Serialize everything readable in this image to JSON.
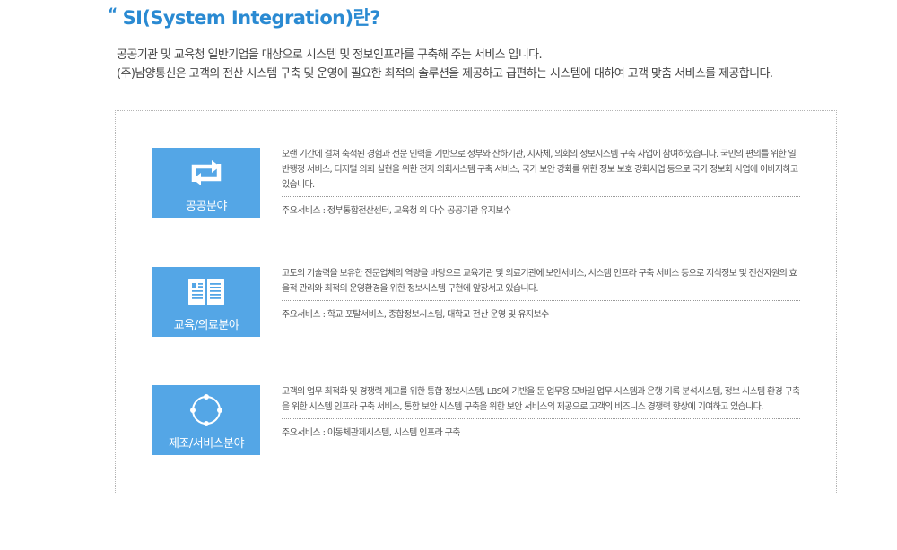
{
  "title": {
    "quote": "“",
    "text": "SI(System Integration)란?"
  },
  "intro": [
    "공공기관 및 교육청 일반기업을 대상으로 시스템 및 정보인프라를 구축해 주는 서비스 입니다.",
    "(주)남양통신은 고객의 전산 시스템 구축 및 운영에 필요한 최적의 솔루션을 제공하고 급편하는 시스템에 대하여 고객  맞춤 서비스를  제공합니다."
  ],
  "services": [
    {
      "icon": "cycle-arrows-icon",
      "label": "공공분야",
      "description": "오랜 기간에 걸쳐 축적된 경험과 전문 인력을 기반으로 정부와 산하기관, 지자체, 의회의 정보시스템 구축 사업에 참여하였습니다. 국민의 편의를 위한 일반행정 서비스, 디지털 의회 실현을 위한 전자 의회시스템 구축 서비스, 국가 보안 강화를 위한 정보 보호 강화사업 등으로 국가 정보화 사업에 이바지하고 있습니다.",
      "main_services": "주요서비스 : 정부통합전산센터, 교육청 외 다수 공공기관  유지보수"
    },
    {
      "icon": "open-book-icon",
      "label": "교육/의료분야",
      "description": "고도의 기술력을 보유한 전문업체의 역량을 바탕으로 교육기관 및 의료기관에 보안서비스, 시스템 인프라 구축 서비스 등으로 지식정보 및  전산자원의 효율적 관리와 최적의 운영환경을 위한 정보시스템 구현에 앞장서고 있습니다.",
      "main_services": "주요서비스 : 학교 포탈서비스, 종합정보시스템, 대학교 전산 운영 및 유지보수"
    },
    {
      "icon": "circle-nodes-icon",
      "label": "제조/서비스분야",
      "description": "고객의 업무 최적화 및 경쟁력 제고를 위한 통합 정보시스템, LBS에 기반을 둔 업무용 모바일 업무 시스템과 은행 기록 분석시스템, 정보 시스템 환경 구축을 위한 시스템 인프라 구축 서비스, 통합 보안 시스템 구축을 위한 보안 서비스의 제공으로 고객의 비즈니스 경쟁력 향상에 기여하고 있습니다.",
      "main_services": "주요서비스 :  이동체관제시스템, 시스템 인프라 구축"
    }
  ],
  "colors": {
    "accent": "#2a8ad2",
    "tile": "#54a6e6"
  }
}
